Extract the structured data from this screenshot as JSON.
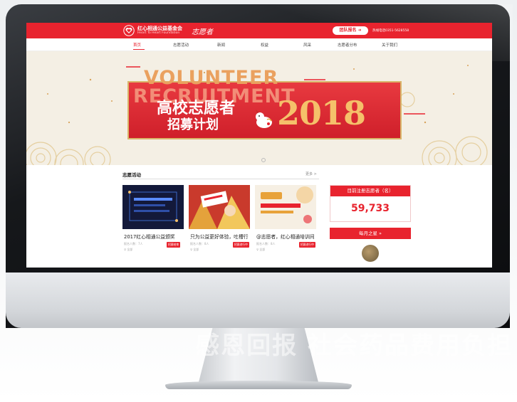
{
  "brand": {
    "name_cn": "红心相通公益基金会",
    "name_en": "Heart To Heart Foundation",
    "script": "志愿者"
  },
  "header": {
    "join_button": "团队报名 ➜",
    "hotline": "热线电话0351-5628558"
  },
  "nav": {
    "items": [
      "首页",
      "志愿活动",
      "新闻",
      "权益",
      "风采",
      "志愿者分布",
      "关于我们"
    ],
    "active": "首页"
  },
  "banner": {
    "en_line1": "VOLUNTEER",
    "en_line2": "RECRUITMENT",
    "cn_line1": "高校志愿者",
    "cn_line2": "招募计划",
    "year": "2018"
  },
  "activities": {
    "title": "志愿活动",
    "more": "更多 >",
    "cards": [
      {
        "title": "2017红心相通公益颁奖",
        "meta1": "报名人数：7人",
        "meta2": "♀ 全部",
        "tag": "招募结束"
      },
      {
        "title": "只为公益更好体验，吐槽行",
        "meta1": "报名人数：8人",
        "meta2": "♀ 全部",
        "tag": "招募进行中"
      },
      {
        "title": "@志愿者，红心相通培训间",
        "meta1": "报名人数：8人",
        "meta2": "♀ 全部",
        "tag": "招募进行中"
      }
    ]
  },
  "stats": {
    "header": "目前注册志愿者（名）",
    "value": "59,733"
  },
  "monthly_star": {
    "header": "每月之星 »"
  },
  "watermark": "感恩回报 社会药品费用负担",
  "colors": {
    "brand_red": "#e8232e",
    "gold": "#f5c06a"
  }
}
